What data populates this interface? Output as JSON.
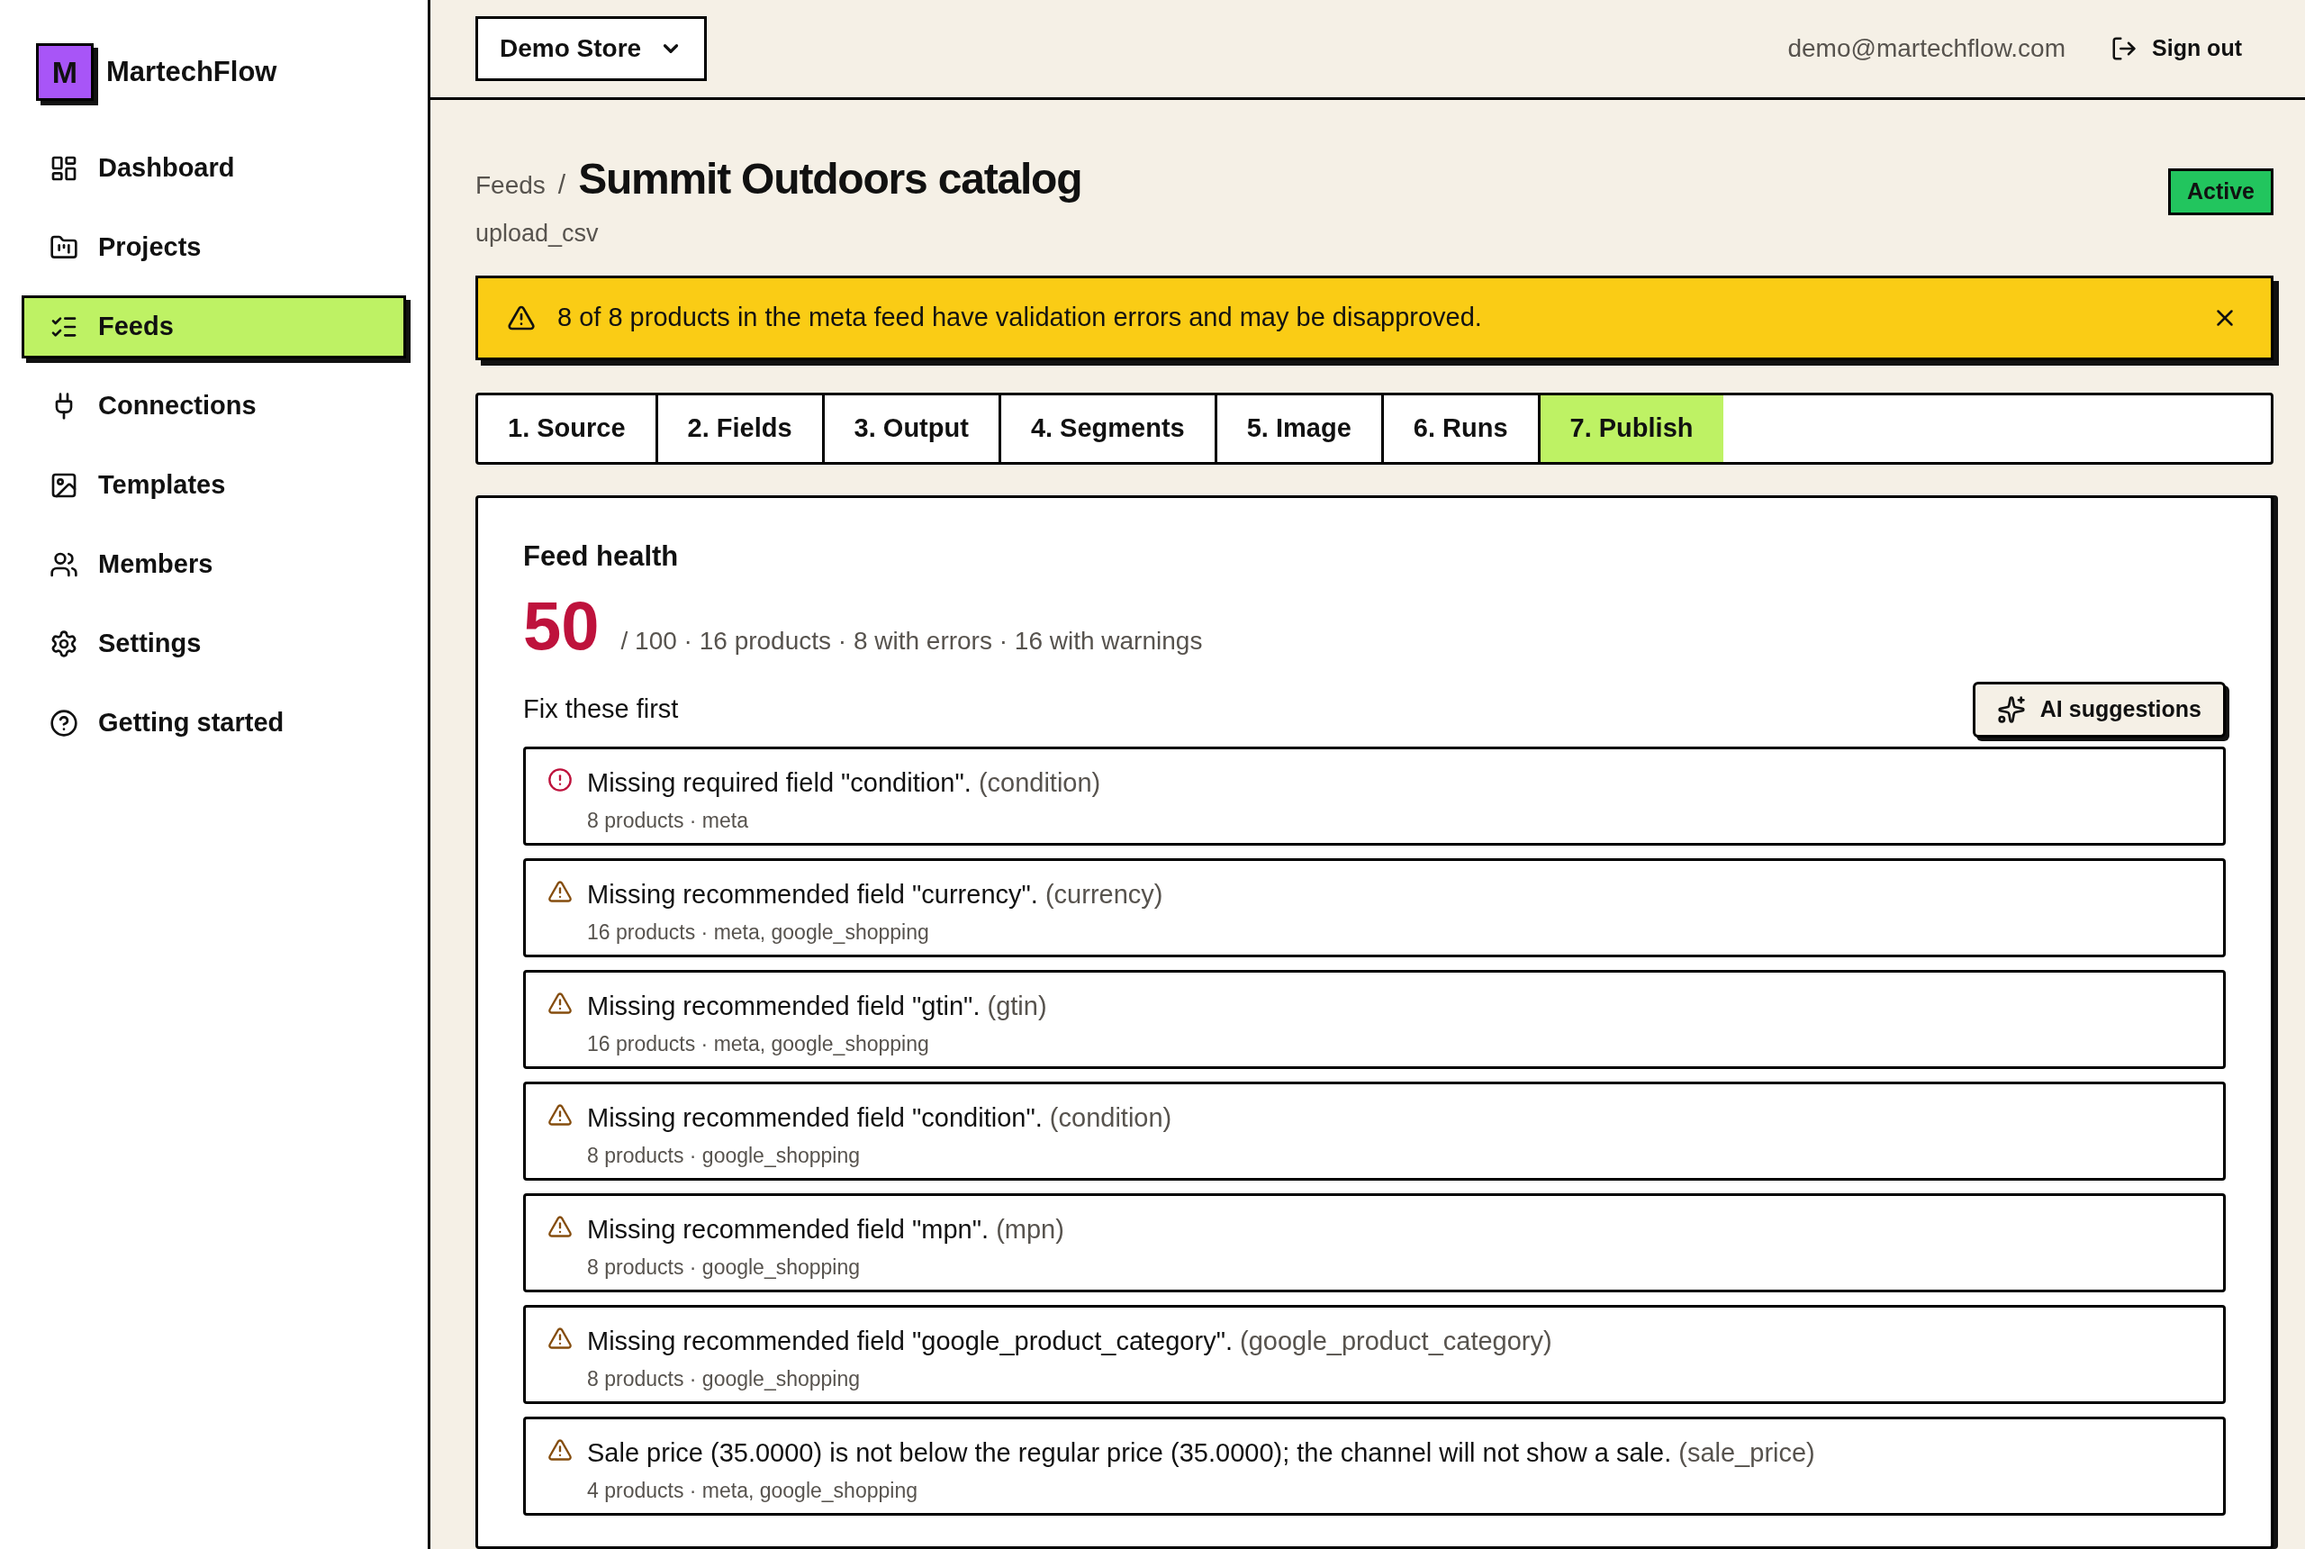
{
  "brand": {
    "logo_letter": "M",
    "name": "MartechFlow"
  },
  "sidebar": {
    "items": [
      {
        "label": "Dashboard",
        "selected": false
      },
      {
        "label": "Projects",
        "selected": false
      },
      {
        "label": "Feeds",
        "selected": true
      },
      {
        "label": "Connections",
        "selected": false
      },
      {
        "label": "Templates",
        "selected": false
      },
      {
        "label": "Members",
        "selected": false
      },
      {
        "label": "Settings",
        "selected": false
      },
      {
        "label": "Getting started",
        "selected": false
      }
    ]
  },
  "header": {
    "store_select": "Demo Store",
    "email": "demo@martechflow.com",
    "sign_out": "Sign out"
  },
  "page": {
    "breadcrumb": "Feeds",
    "separator": "/",
    "title": "Summit Outdoors catalog",
    "subtitle": "upload_csv",
    "status": "Active"
  },
  "alert": {
    "message": "8 of 8 products in the meta feed have validation errors and may be disapproved."
  },
  "tabs": [
    {
      "label": "1. Source",
      "selected": false
    },
    {
      "label": "2. Fields",
      "selected": false
    },
    {
      "label": "3. Output",
      "selected": false
    },
    {
      "label": "4. Segments",
      "selected": false
    },
    {
      "label": "5. Image",
      "selected": false
    },
    {
      "label": "6. Runs",
      "selected": false
    },
    {
      "label": "7. Publish",
      "selected": true
    }
  ],
  "health": {
    "title": "Feed health",
    "score": "50",
    "summary": "/ 100 · 16 products · 8 with errors · 16 with warnings",
    "fix_title": "Fix these first",
    "ai_button": "AI suggestions",
    "issues": [
      {
        "kind": "error",
        "message": "Missing required field \"condition\".",
        "field": "(condition)",
        "detail": "8 products · meta"
      },
      {
        "kind": "warning",
        "message": "Missing recommended field \"currency\".",
        "field": "(currency)",
        "detail": "16 products · meta, google_shopping"
      },
      {
        "kind": "warning",
        "message": "Missing recommended field \"gtin\".",
        "field": "(gtin)",
        "detail": "16 products · meta, google_shopping"
      },
      {
        "kind": "warning",
        "message": "Missing recommended field \"condition\".",
        "field": "(condition)",
        "detail": "8 products · google_shopping"
      },
      {
        "kind": "warning",
        "message": "Missing recommended field \"mpn\".",
        "field": "(mpn)",
        "detail": "8 products · google_shopping"
      },
      {
        "kind": "warning",
        "message": "Missing recommended field \"google_product_category\".",
        "field": "(google_product_category)",
        "detail": "8 products · google_shopping"
      },
      {
        "kind": "warning",
        "message": "Sale price (35.0000) is not below the regular price (35.0000); the channel will not show a sale.",
        "field": "(sale_price)",
        "detail": "4 products · meta, google_shopping"
      }
    ]
  }
}
